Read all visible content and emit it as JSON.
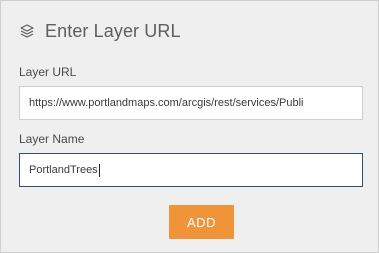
{
  "dialog": {
    "title": "Enter Layer URL",
    "title_icon": "layers-icon"
  },
  "layer_url": {
    "label": "Layer URL",
    "value": "https://www.portlandmaps.com/arcgis/rest/services/Publi"
  },
  "layer_name": {
    "label": "Layer Name",
    "value": "PortlandTrees"
  },
  "actions": {
    "add_label": "ADD"
  },
  "colors": {
    "accent": "#f0943a",
    "focus_border": "#2f4f7f",
    "panel_bg": "#efefef"
  }
}
